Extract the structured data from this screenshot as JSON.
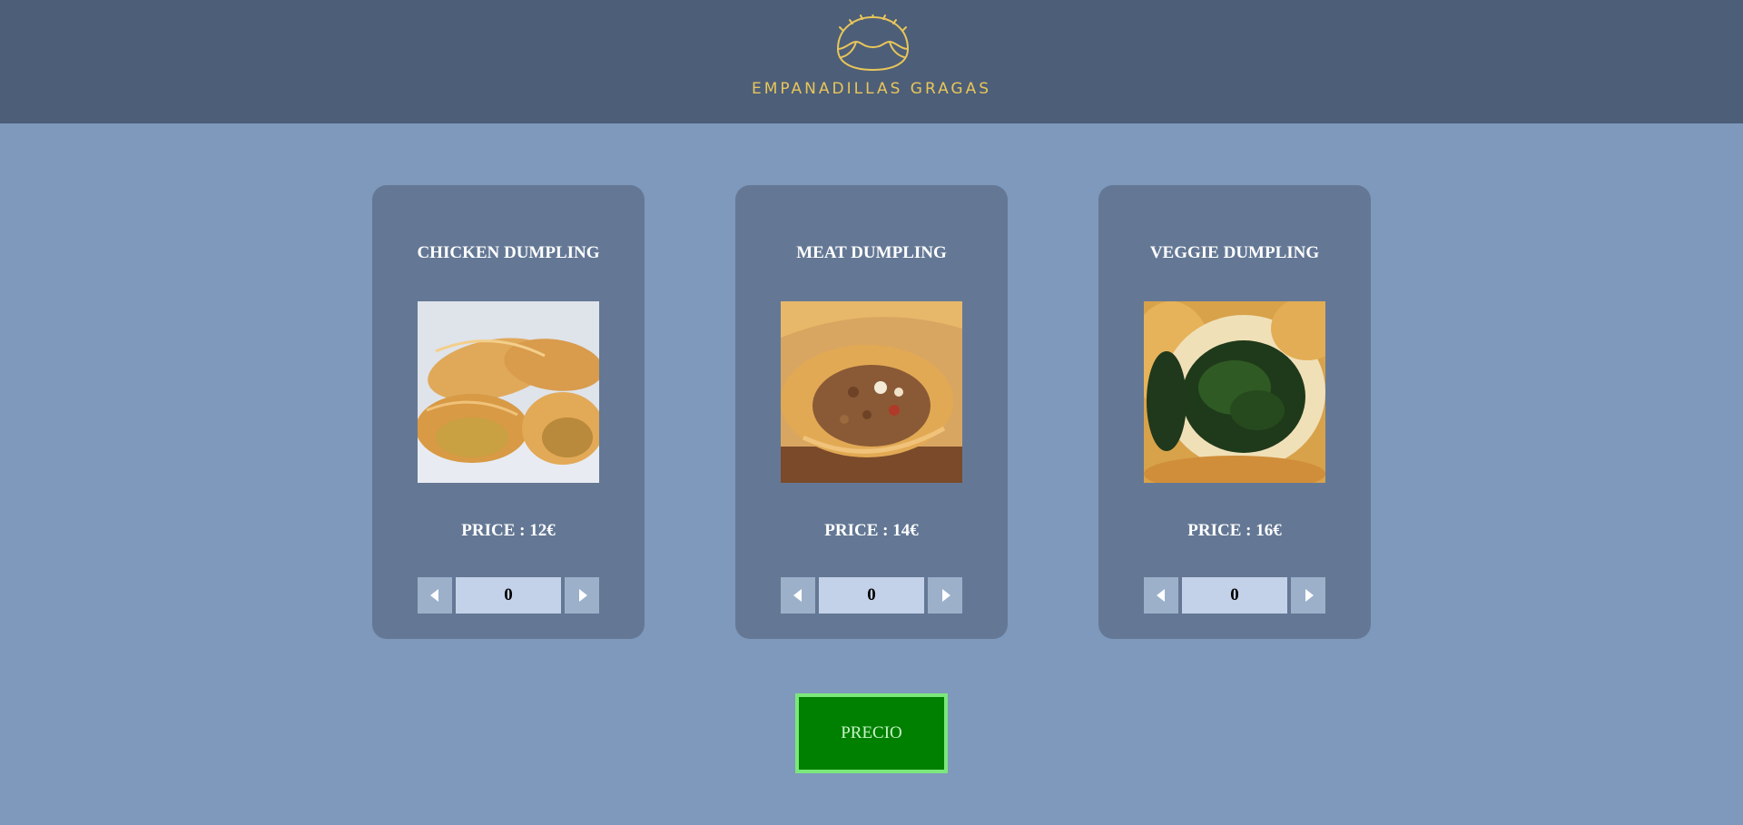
{
  "brand": {
    "name": "EMPANADILLAS GRAGAS",
    "logo_icon": "empanada-logo-icon",
    "accent_color": "#e8c65a"
  },
  "products": [
    {
      "title": "CHICKEN DUMPLING",
      "price_label": "PRICE : 12€",
      "quantity": "0",
      "image": "chicken-dumpling-photo"
    },
    {
      "title": "MEAT DUMPLING",
      "price_label": "PRICE : 14€",
      "quantity": "0",
      "image": "meat-dumpling-photo"
    },
    {
      "title": "VEGGIE DUMPLING",
      "price_label": "PRICE : 16€",
      "quantity": "0",
      "image": "veggie-dumpling-photo"
    }
  ],
  "stepper_icons": {
    "decrement": "caret-left-icon",
    "increment": "caret-right-icon"
  },
  "actions": {
    "price_button": "PRECIO",
    "price_button_color": "#008000"
  }
}
